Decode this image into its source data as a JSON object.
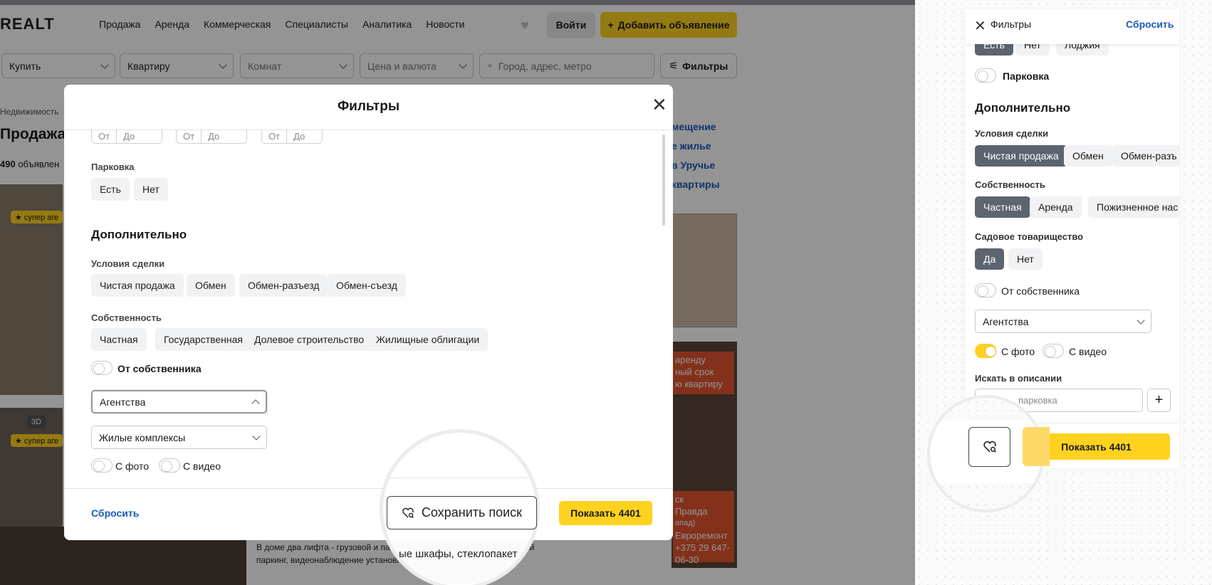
{
  "header": {
    "logo": "REALT",
    "nav": [
      "Продажа",
      "Аренда",
      "Коммерческая",
      "Специалисты",
      "Аналитика",
      "Новости"
    ],
    "login": "Войти",
    "add": "Добавить объявление"
  },
  "searchbar": {
    "buy": "Купить",
    "type": "Квартиру",
    "rooms": "Комнат",
    "price": "Цена и валюта",
    "location_placeholder": "Город, адрес, метро",
    "filters": "Фильтры"
  },
  "background": {
    "breadcrumb": "Недвижимость",
    "heading": "Продажа",
    "count_num": "490",
    "count_word": "объявлен",
    "badge_super": "★ супер аге",
    "badge_3d": "3D",
    "links": [
      "мещение",
      "е жилье",
      "в Уручье",
      "квартиры"
    ],
    "ad_lines": [
      "аренду",
      "ный срок",
      "ю квартиру"
    ],
    "ad_lines2": [
      "ск",
      "Правда",
      "апад)"
    ],
    "ad_remont": "Евроремонт",
    "ad_phone": "+375 29 647-06-30",
    "listing_text": "В доме два лифта - грузовой и пассажирский, велопарковки и крытый паркинг, видеонаблюдение установлено ..."
  },
  "modal": {
    "title": "Фильтры",
    "range_from": "От",
    "range_to": "До",
    "parking_label": "Парковка",
    "parking_options": [
      "Есть",
      "Нет"
    ],
    "more_heading": "Дополнительно",
    "deal_label": "Условия сделки",
    "deal_options": [
      "Чистая продажа",
      "Обмен",
      "Обмен-разъезд",
      "Обмен-съезд"
    ],
    "ownership_label": "Собственность",
    "ownership_options": [
      "Частная",
      "Государственная",
      "Долевое строительство",
      "Жилищные облигации"
    ],
    "owner_toggle": "От собственника",
    "agencies": "Агентства",
    "complexes": "Жилые комплексы",
    "photo": "С фото",
    "video": "С видео",
    "reset": "Сбросить",
    "save_search": "Сохранить поиск",
    "show": "Показать 4401",
    "mag_text": "ые шкафы, стеклопакет"
  },
  "panel": {
    "title": "Фильтры",
    "reset": "Сбросить",
    "balcony_options": [
      "Есть",
      "Нет",
      "Лоджия"
    ],
    "parking": "Парковка",
    "more_heading": "Дополнительно",
    "deal_label": "Условия сделки",
    "deal_options": [
      "Чистая продажа",
      "Обмен",
      "Обмен-разъ"
    ],
    "ownership_label": "Собственность",
    "ownership_options": [
      "Частная",
      "Аренда",
      "Пожизненное нас"
    ],
    "garden_label": "Садовое товарищество",
    "garden_options": [
      "Да",
      "Нет"
    ],
    "owner_toggle": "От собственника",
    "agencies": "Агентства",
    "photo": "С фото",
    "video": "С видео",
    "desc_label": "Искать в описании",
    "desc_value": "парковка",
    "show": "Показать 4401"
  },
  "colors": {
    "accent": "#ffd21f",
    "link": "#1a5bb8",
    "chip_active": "#5c6470"
  }
}
